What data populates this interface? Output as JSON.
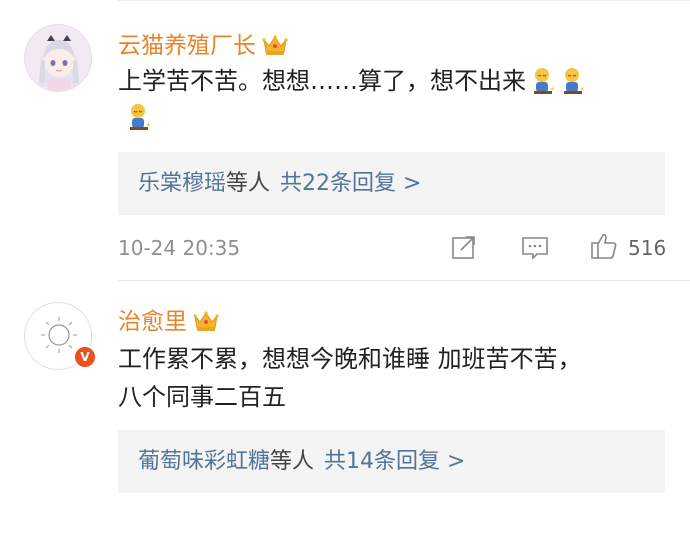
{
  "comments": [
    {
      "username": "云猫养殖厂长",
      "text_line1": "上学苦不苦。想想……算了，想不出来",
      "replies_names": "乐棠穆瑶",
      "replies_etc": "等人",
      "replies_count": "共22条回复 >",
      "time": "10-24 20:35",
      "likes": "516",
      "icons": {
        "share": "share-icon",
        "comment": "comment-icon",
        "like": "thumbs-up-icon"
      }
    },
    {
      "username": "治愈里",
      "text_line1": "工作累不累，想想今晚和谁睡 加班苦不苦，",
      "text_line2": "八个同事二百五",
      "replies_names": "葡萄味彩虹糖",
      "replies_etc": "等人",
      "replies_count": "共14条回复 >",
      "badge": "V"
    }
  ],
  "colors": {
    "username": "#e8842a",
    "link": "#53749a",
    "text": "#222222",
    "meta": "#8f8f8f",
    "reply_bg": "#f4f4f4",
    "vip_badge": "#e8521f"
  }
}
